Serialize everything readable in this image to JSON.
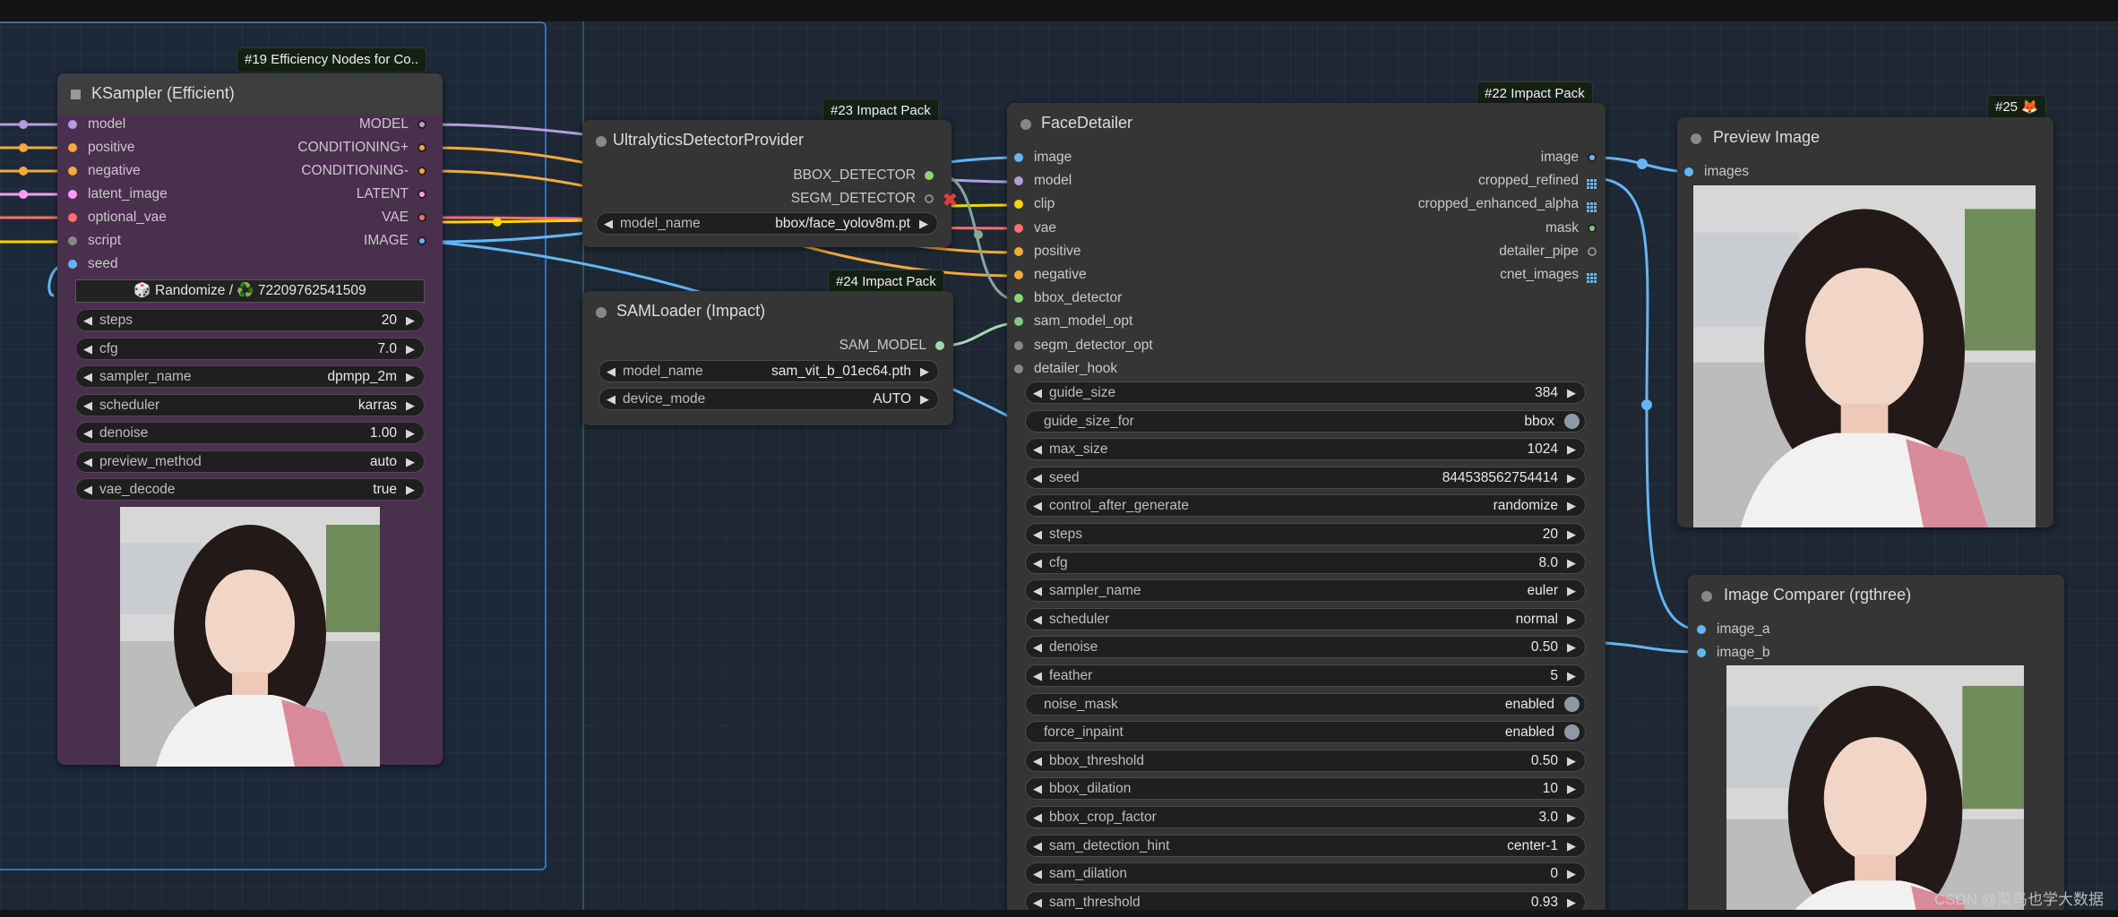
{
  "colors": {
    "model": "#b39ddb",
    "conditioning": "#f3a93b",
    "latent": "#ff9cf9",
    "vae": "#ff6e6e",
    "image": "#64b5f6",
    "script": "#888888",
    "clip": "#ffd500",
    "mask": "#81c784",
    "bbox": "#89d872",
    "sam": "#a6d8b0",
    "purple_bg": "#4b2f4f",
    "node_bg": "#353535"
  },
  "ksampler": {
    "badge": "#19 Efficiency Nodes for Co..",
    "title": "KSampler (Efficient)",
    "inputs": [
      "model",
      "positive",
      "negative",
      "latent_image",
      "optional_vae",
      "script",
      "seed"
    ],
    "outputs": [
      "MODEL",
      "CONDITIONING+",
      "CONDITIONING-",
      "LATENT",
      "VAE",
      "IMAGE"
    ],
    "seed_button": "🎲 Randomize / ♻️ 72209762541509",
    "widgets": [
      {
        "label": "steps",
        "value": "20"
      },
      {
        "label": "cfg",
        "value": "7.0"
      },
      {
        "label": "sampler_name",
        "value": "dpmpp_2m"
      },
      {
        "label": "scheduler",
        "value": "karras"
      },
      {
        "label": "denoise",
        "value": "1.00"
      },
      {
        "label": "preview_method",
        "value": "auto"
      },
      {
        "label": "vae_decode",
        "value": "true"
      }
    ]
  },
  "ultralytics": {
    "badge": "#23 Impact Pack",
    "title": "UltralyticsDetectorProvider",
    "outputs": [
      "BBOX_DETECTOR",
      "SEGM_DETECTOR"
    ],
    "widget": {
      "label": "model_name",
      "value": "bbox/face_yolov8m.pt"
    }
  },
  "samloader": {
    "badge": "#24 Impact Pack",
    "title": "SAMLoader (Impact)",
    "outputs": [
      "SAM_MODEL"
    ],
    "widgets": [
      {
        "label": "model_name",
        "value": "sam_vit_b_01ec64.pth"
      },
      {
        "label": "device_mode",
        "value": "AUTO"
      }
    ]
  },
  "facedetailer": {
    "badge": "#22 Impact Pack",
    "title": "FaceDetailer",
    "inputs": [
      "image",
      "model",
      "clip",
      "vae",
      "positive",
      "negative",
      "bbox_detector",
      "sam_model_opt",
      "segm_detector_opt",
      "detailer_hook"
    ],
    "outputs": [
      "image",
      "cropped_refined",
      "cropped_enhanced_alpha",
      "mask",
      "detailer_pipe",
      "cnet_images"
    ],
    "widgets": [
      {
        "label": "guide_size",
        "value": "384",
        "kind": "combo"
      },
      {
        "label": "guide_size_for",
        "value": "bbox",
        "kind": "toggle"
      },
      {
        "label": "max_size",
        "value": "1024",
        "kind": "combo"
      },
      {
        "label": "seed",
        "value": "844538562754414",
        "kind": "combo"
      },
      {
        "label": "control_after_generate",
        "value": "randomize",
        "kind": "combo"
      },
      {
        "label": "steps",
        "value": "20",
        "kind": "combo"
      },
      {
        "label": "cfg",
        "value": "8.0",
        "kind": "combo"
      },
      {
        "label": "sampler_name",
        "value": "euler",
        "kind": "combo"
      },
      {
        "label": "scheduler",
        "value": "normal",
        "kind": "combo"
      },
      {
        "label": "denoise",
        "value": "0.50",
        "kind": "combo"
      },
      {
        "label": "feather",
        "value": "5",
        "kind": "combo"
      },
      {
        "label": "noise_mask",
        "value": "enabled",
        "kind": "toggle"
      },
      {
        "label": "force_inpaint",
        "value": "enabled",
        "kind": "toggle"
      },
      {
        "label": "bbox_threshold",
        "value": "0.50",
        "kind": "combo"
      },
      {
        "label": "bbox_dilation",
        "value": "10",
        "kind": "combo"
      },
      {
        "label": "bbox_crop_factor",
        "value": "3.0",
        "kind": "combo"
      },
      {
        "label": "sam_detection_hint",
        "value": "center-1",
        "kind": "combo"
      },
      {
        "label": "sam_dilation",
        "value": "0",
        "kind": "combo"
      },
      {
        "label": "sam_threshold",
        "value": "0.93",
        "kind": "combo"
      }
    ]
  },
  "preview": {
    "badge": "#25 🦊",
    "title": "Preview Image",
    "inputs": [
      "images"
    ]
  },
  "comparer": {
    "title": "Image Comparer (rgthree)",
    "inputs": [
      "image_a",
      "image_b"
    ]
  },
  "watermark": "CSDN @菜鸟也学大数据"
}
